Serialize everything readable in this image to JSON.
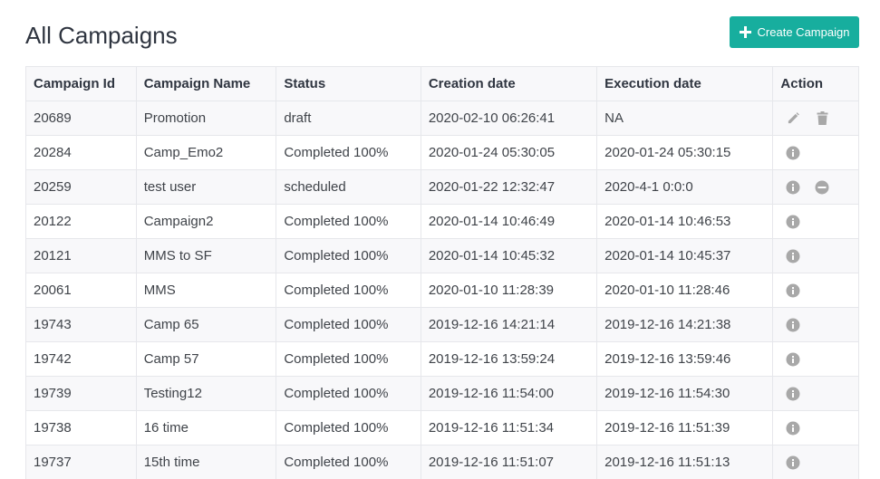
{
  "header": {
    "title": "All Campaigns",
    "create_button_label": "Create Campaign"
  },
  "colors": {
    "accent": "#17ae9e",
    "icon_gray": "#a8a8a8",
    "row_stripe": "#f8f8fa",
    "border": "#e6e7eb"
  },
  "table": {
    "columns": [
      "Campaign Id",
      "Campaign Name",
      "Status",
      "Creation date",
      "Execution date",
      "Action"
    ],
    "rows": [
      {
        "id": "20689",
        "name": "Promotion",
        "status": "draft",
        "created": "2020-02-10 06:26:41",
        "executed": "NA",
        "actions": [
          "pencil-icon",
          "trash-icon"
        ]
      },
      {
        "id": "20284",
        "name": "Camp_Emo2",
        "status": "Completed 100%",
        "created": "2020-01-24 05:30:05",
        "executed": "2020-01-24 05:30:15",
        "actions": [
          "info-icon"
        ]
      },
      {
        "id": "20259",
        "name": "test user",
        "status": "scheduled",
        "created": "2020-01-22 12:32:47",
        "executed": "2020-4-1 0:0:0",
        "actions": [
          "info-icon",
          "minus-circle-icon"
        ]
      },
      {
        "id": "20122",
        "name": "Campaign2",
        "status": "Completed 100%",
        "created": "2020-01-14 10:46:49",
        "executed": "2020-01-14 10:46:53",
        "actions": [
          "info-icon"
        ]
      },
      {
        "id": "20121",
        "name": "MMS to SF",
        "status": "Completed 100%",
        "created": "2020-01-14 10:45:32",
        "executed": "2020-01-14 10:45:37",
        "actions": [
          "info-icon"
        ]
      },
      {
        "id": "20061",
        "name": "MMS",
        "status": "Completed 100%",
        "created": "2020-01-10 11:28:39",
        "executed": "2020-01-10 11:28:46",
        "actions": [
          "info-icon"
        ]
      },
      {
        "id": "19743",
        "name": "Camp 65",
        "status": "Completed 100%",
        "created": "2019-12-16 14:21:14",
        "executed": "2019-12-16 14:21:38",
        "actions": [
          "info-icon"
        ]
      },
      {
        "id": "19742",
        "name": "Camp 57",
        "status": "Completed 100%",
        "created": "2019-12-16 13:59:24",
        "executed": "2019-12-16 13:59:46",
        "actions": [
          "info-icon"
        ]
      },
      {
        "id": "19739",
        "name": "Testing12",
        "status": "Completed 100%",
        "created": "2019-12-16 11:54:00",
        "executed": "2019-12-16 11:54:30",
        "actions": [
          "info-icon"
        ]
      },
      {
        "id": "19738",
        "name": "16 time",
        "status": "Completed 100%",
        "created": "2019-12-16 11:51:34",
        "executed": "2019-12-16 11:51:39",
        "actions": [
          "info-icon"
        ]
      },
      {
        "id": "19737",
        "name": "15th time",
        "status": "Completed 100%",
        "created": "2019-12-16 11:51:07",
        "executed": "2019-12-16 11:51:13",
        "actions": [
          "info-icon"
        ]
      }
    ]
  }
}
